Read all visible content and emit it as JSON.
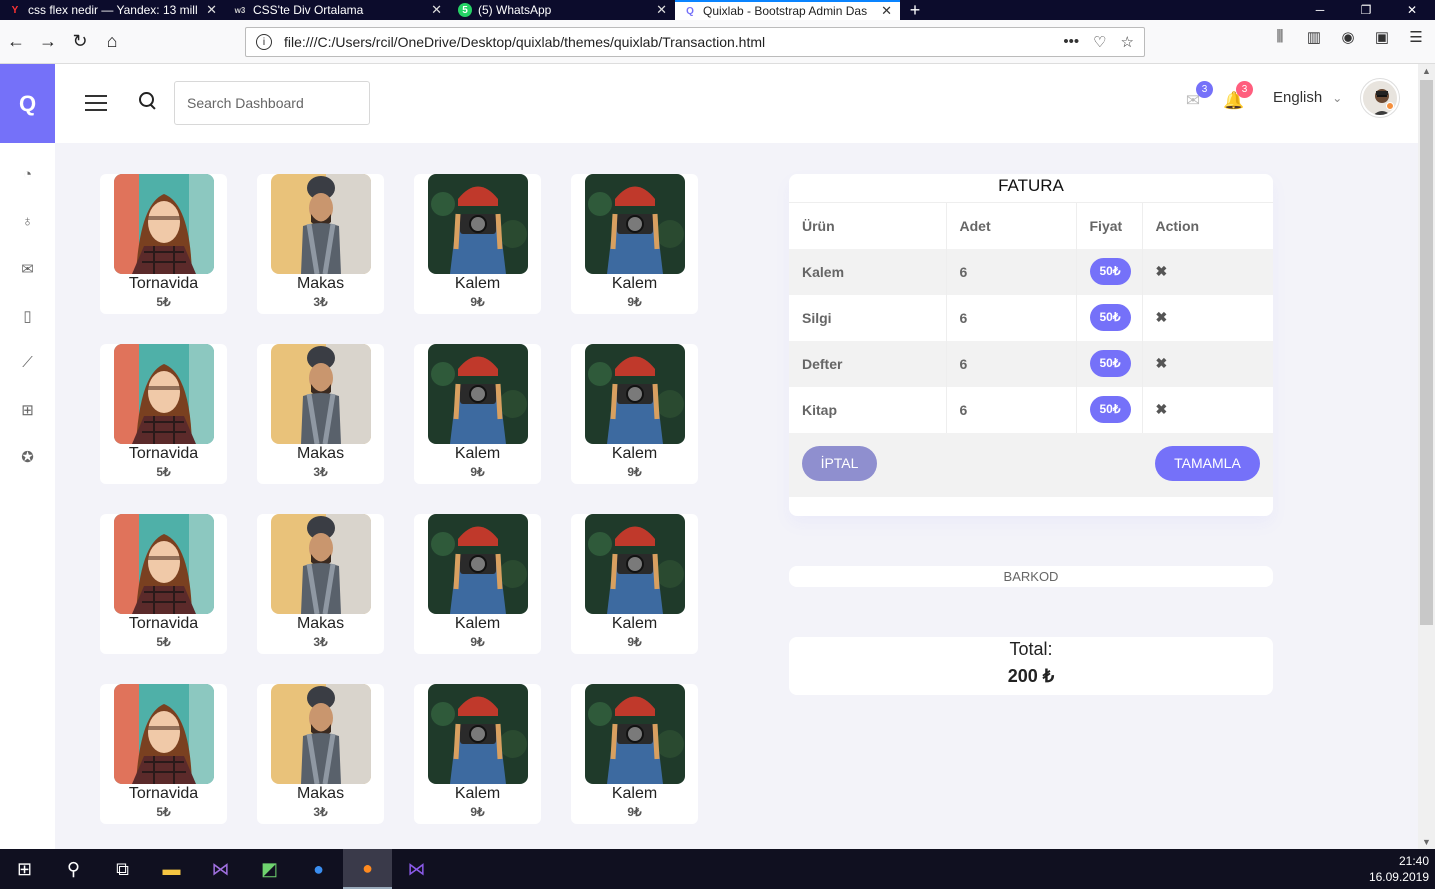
{
  "browser": {
    "tabs": [
      {
        "label": "css flex nedir — Yandex: 13 mill",
        "favicon": "Y"
      },
      {
        "label": "CSS'te Div Ortalama",
        "favicon": "w3"
      },
      {
        "label": "(5) WhatsApp",
        "favicon": "5"
      },
      {
        "label": "Quixlab - Bootstrap Admin Das",
        "favicon": "Q"
      }
    ],
    "url": "file:///C:/Users/rcil/OneDrive/Desktop/quixlab/themes/quixlab/Transaction.html"
  },
  "app": {
    "brand_letter": "Q",
    "search_placeholder": "Search Dashboard",
    "mail_badge": "3",
    "notif_badge": "3",
    "language": "English"
  },
  "products": [
    {
      "name": "Tornavida",
      "price": "5₺",
      "img": "woman"
    },
    {
      "name": "Makas",
      "price": "3₺",
      "img": "man"
    },
    {
      "name": "Kalem",
      "price": "9₺",
      "img": "camera"
    },
    {
      "name": "Kalem",
      "price": "9₺",
      "img": "camera"
    },
    {
      "name": "Tornavida",
      "price": "5₺",
      "img": "woman"
    },
    {
      "name": "Makas",
      "price": "3₺",
      "img": "man"
    },
    {
      "name": "Kalem",
      "price": "9₺",
      "img": "camera"
    },
    {
      "name": "Kalem",
      "price": "9₺",
      "img": "camera"
    },
    {
      "name": "Tornavida",
      "price": "5₺",
      "img": "woman"
    },
    {
      "name": "Makas",
      "price": "3₺",
      "img": "man"
    },
    {
      "name": "Kalem",
      "price": "9₺",
      "img": "camera"
    },
    {
      "name": "Kalem",
      "price": "9₺",
      "img": "camera"
    },
    {
      "name": "Tornavida",
      "price": "5₺",
      "img": "woman"
    },
    {
      "name": "Makas",
      "price": "3₺",
      "img": "man"
    },
    {
      "name": "Kalem",
      "price": "9₺",
      "img": "camera"
    },
    {
      "name": "Kalem",
      "price": "9₺",
      "img": "camera"
    }
  ],
  "invoice": {
    "title": "FATURA",
    "headers": [
      "Ürün",
      "Adet",
      "Fiyat",
      "Action"
    ],
    "rows": [
      {
        "product": "Kalem",
        "qty": "6",
        "price": "50₺"
      },
      {
        "product": "Silgi",
        "qty": "6",
        "price": "50₺"
      },
      {
        "product": "Defter",
        "qty": "6",
        "price": "50₺"
      },
      {
        "product": "Kitap",
        "qty": "6",
        "price": "50₺"
      }
    ],
    "cancel_label": "İPTAL",
    "complete_label": "TAMAMLA"
  },
  "barcode_label": "BARKOD",
  "total": {
    "label": "Total:",
    "value": "200 ₺"
  },
  "taskbar": {
    "time": "21:40",
    "date": "16.09.2019"
  },
  "colors": {
    "accent": "#7571f9",
    "background": "#f3f3f9"
  }
}
